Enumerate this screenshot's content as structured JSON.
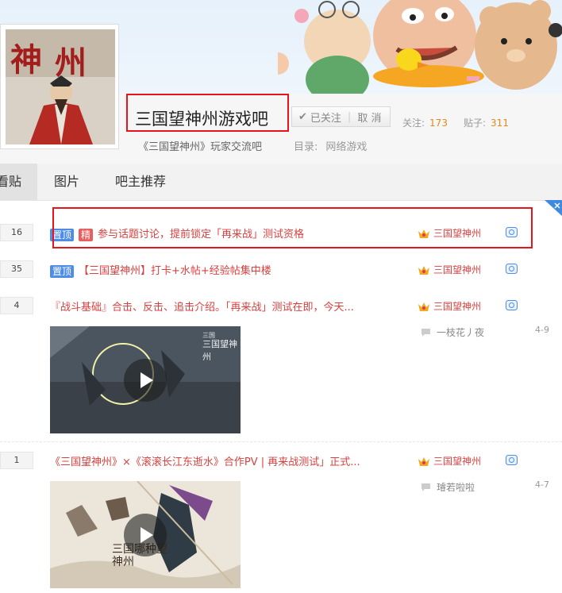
{
  "forum": {
    "name": "三国望神州游戏吧",
    "slogan": "《三国望神州》玩家交流吧",
    "category_label": "目录:",
    "category_value": "网络游戏",
    "follow_label": "已关注",
    "unfollow_label": "取 消",
    "followers_label": "关注:",
    "followers_count": "173",
    "posts_label": "贴子:",
    "posts_count": "311"
  },
  "avatar_text": "神州",
  "tabs": [
    {
      "label": "看贴"
    },
    {
      "label": "图片"
    },
    {
      "label": "吧主推荐"
    }
  ],
  "threads": [
    {
      "replies": "16",
      "tags": [
        "置顶",
        "精"
      ],
      "title": "参与话题讨论，提前锁定「再来战」测试资格",
      "author": "三国望神州"
    },
    {
      "replies": "35",
      "tags": [
        "置顶"
      ],
      "title": "【三国望神州】打卡+水帖+经验帖集中楼",
      "author": "三国望神州"
    },
    {
      "replies": "4",
      "title": "『战斗基础』合击、反击、追击介绍。「再来战」测试在即，今天...",
      "author": "三国望神州",
      "last_user": "一枝花丿夜",
      "date": "4-9",
      "video_logo": "三国望神州"
    },
    {
      "replies": "1",
      "title": "《三国望神州》×《滚滚长江东逝水》合作PV | 再来战测试」正式...",
      "author": "三国望神州",
      "last_user": "璿若啦啦",
      "date": "4-7",
      "video_logo": "三国哪种望神州"
    }
  ],
  "colors": {
    "accent_red": "#d8413f",
    "tag_blue": "#4e8ce6",
    "tag_red": "#e85e5e",
    "highlight": "#e8141b",
    "count_orange": "#e2891c"
  }
}
